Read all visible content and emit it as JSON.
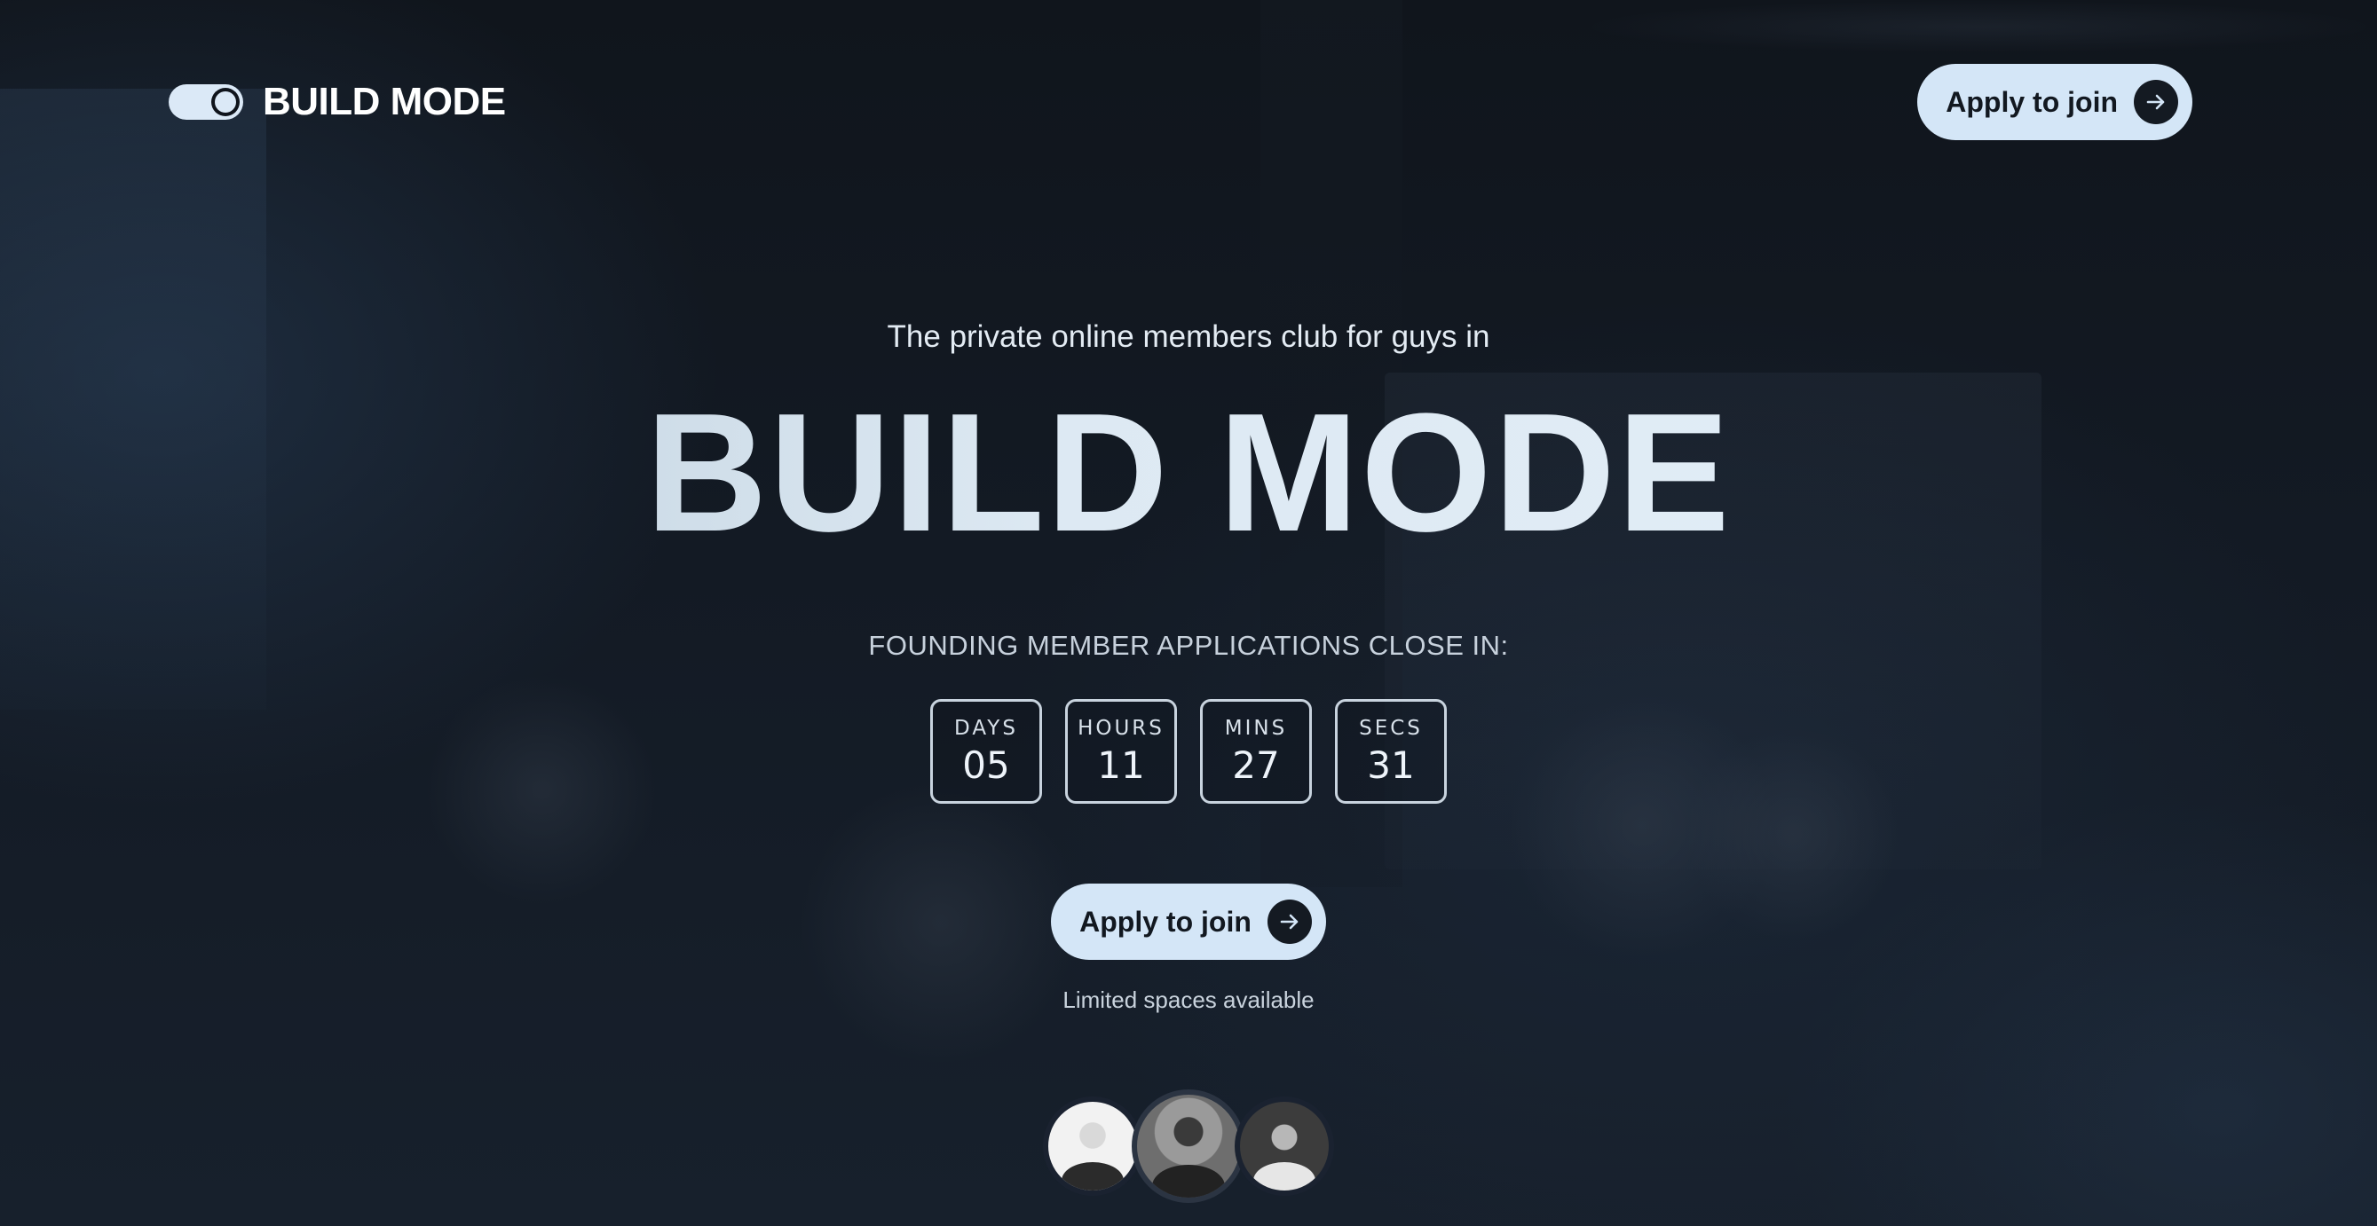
{
  "header": {
    "brand_name": "BUILD MODE",
    "cta_label": "Apply to join"
  },
  "hero": {
    "tagline": "The private online members club for guys in",
    "title": "BUILD MODE",
    "countdown_label": "FOUNDING MEMBER APPLICATIONS CLOSE IN:",
    "countdown": [
      {
        "unit": "DAYS",
        "value": "05"
      },
      {
        "unit": "HOURS",
        "value": "11"
      },
      {
        "unit": "MINS",
        "value": "27"
      },
      {
        "unit": "SECS",
        "value": "31"
      }
    ],
    "cta_label": "Apply to join",
    "note": "Limited spaces available"
  },
  "icons": {
    "toggle": "toggle-icon",
    "arrow": "arrow-right-icon"
  },
  "colors": {
    "background": "#0f141c",
    "button": "#d4e6f7",
    "button_text": "#121820",
    "accent_text": "#dde9f3"
  }
}
